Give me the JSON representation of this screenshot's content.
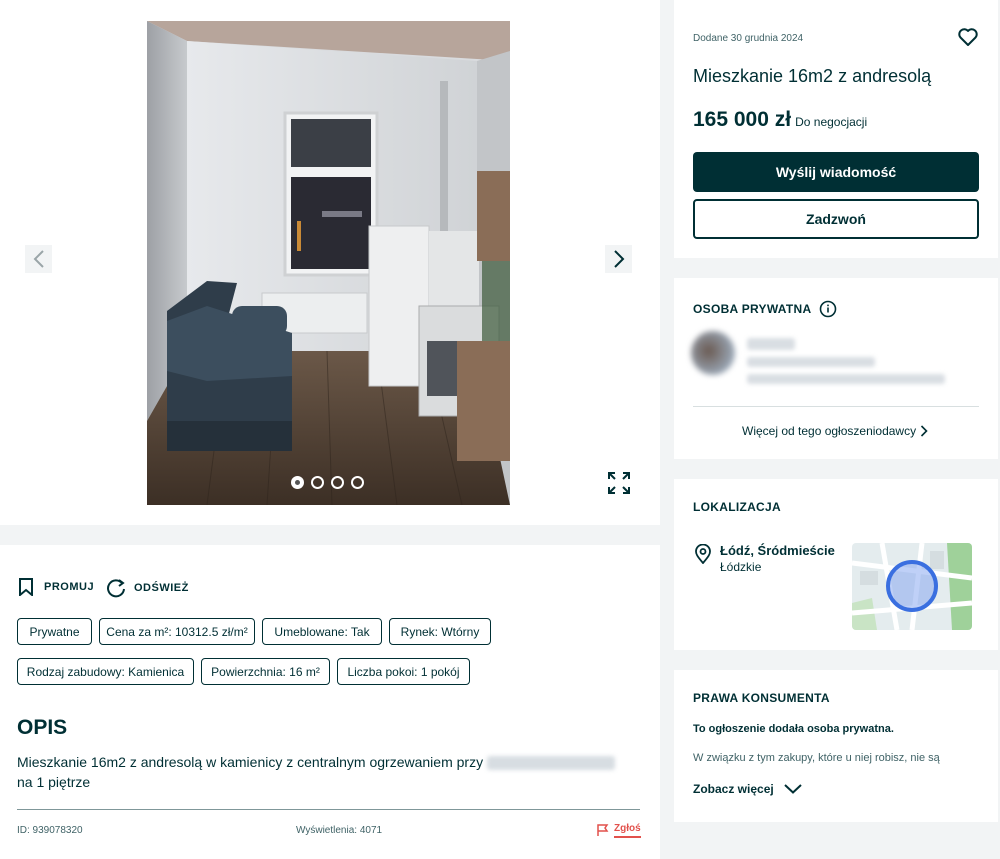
{
  "gallery": {
    "photo_alt": "",
    "dot_count": 4,
    "active_index": 0
  },
  "actions": {
    "promote_label": "PROMUJ",
    "refresh_label": "ODŚWIEŻ"
  },
  "tags": [
    "Prywatne",
    "Cena za m²: 10312.5 zł/m²",
    "Umeblowane: Tak",
    "Rynek: Wtórny",
    "Rodzaj zabudowy: Kamienica",
    "Powierzchnia: 16 m²",
    "Liczba pokoi: 1 pokój"
  ],
  "description": {
    "title": "OPIS",
    "text_before": "Mieszkanie 16m2 z andresolą w kamienicy z centralnym ogrzewaniem przy",
    "text_after": "na 1 piętrze"
  },
  "footer": {
    "id_text": "ID: 939078320",
    "views_text": "Wyświetlenia: 4071",
    "report_label": "Zgłoś"
  },
  "listing": {
    "date": "Dodane 30 grudnia 2024",
    "title": "Mieszkanie 16m2 z andresolą",
    "price": "165 000 zł",
    "negotiable": "Do negocjacji",
    "message_button": "Wyślij wiadomość",
    "call_button": "Zadzwoń"
  },
  "seller": {
    "heading": "OSOBA PRYWATNA",
    "more_link": "Więcej od tego ogłoszeniodawcy"
  },
  "location": {
    "heading": "LOKALIZACJA",
    "city": "Łódź, Śródmieście",
    "region": "Łódzkie"
  },
  "rights": {
    "heading": "PRAWA KONSUMENTA",
    "subheading": "To ogłoszenie dodała osoba prywatna.",
    "text": "W związku z tym zakupy, które u niej robisz, nie są",
    "see_more": "Zobacz więcej"
  },
  "colors": {
    "primary": "#002f34",
    "report": "#e2514c",
    "background": "#f2f4f5",
    "map_circle": "#3a6fe0"
  }
}
